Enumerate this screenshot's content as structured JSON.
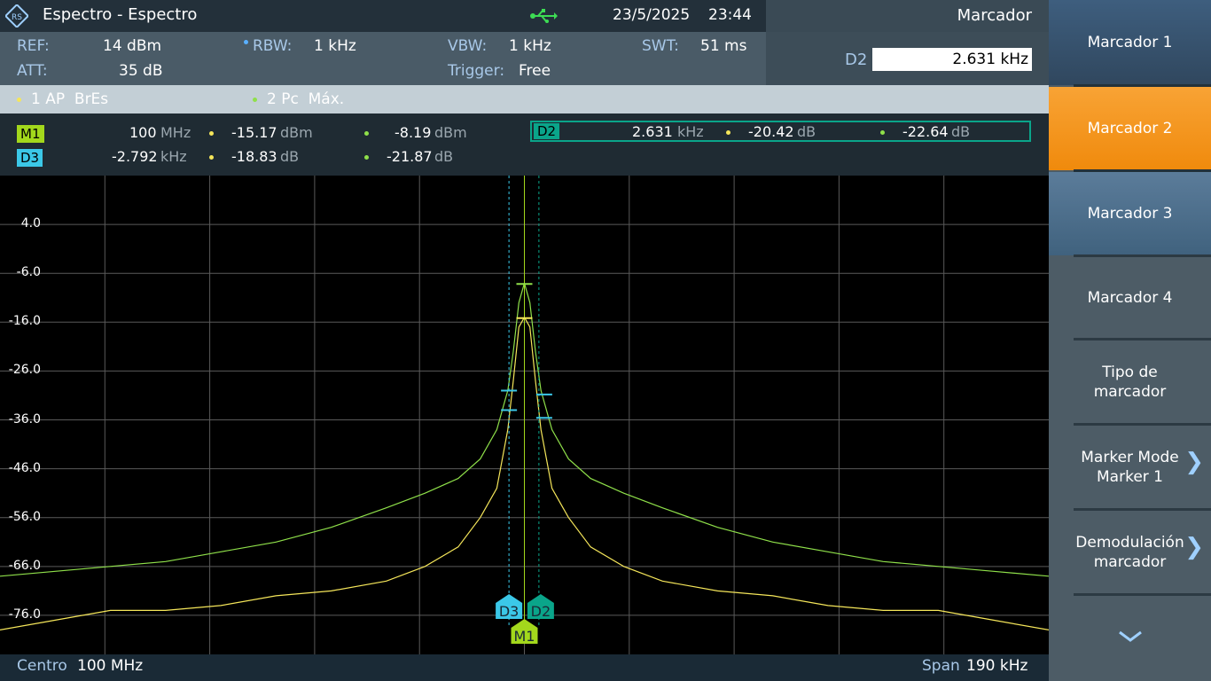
{
  "titlebar": {
    "logo": "rohde-schwarz-logo",
    "title": "Espectro - Espectro",
    "usb_icon": "usb-icon",
    "date": "23/5/2025",
    "time": "23:44",
    "panel_title": "Marcador"
  },
  "settings": {
    "ref_label": "REF:",
    "ref_value": "14 dBm",
    "att_label": "ATT:",
    "att_value": "35 dB",
    "rbw_label": "RBW:",
    "rbw_value": "1 kHz",
    "vbw_label": "VBW:",
    "vbw_value": "1 kHz",
    "trigger_label": "Trigger:",
    "trigger_value": "Free",
    "swt_label": "SWT:",
    "swt_value": "51 ms",
    "marker_input_label": "D2",
    "marker_input_value": "2.631 kHz"
  },
  "traces": {
    "t1": "1 AP  BrEs",
    "t2": "2 Pc  Máx."
  },
  "marker_table": {
    "m1": {
      "tag": "M1",
      "x_val": "100",
      "x_unit": "MHz",
      "t1_val": "-15.17",
      "t1_unit": "dBm",
      "t2_val": "-8.19",
      "t2_unit": "dBm"
    },
    "d3": {
      "tag": "D3",
      "x_val": "-2.792",
      "x_unit": "kHz",
      "t1_val": "-18.83",
      "t1_unit": "dB",
      "t2_val": "-21.87",
      "t2_unit": "dB"
    },
    "d2": {
      "tag": "D2",
      "x_val": "2.631",
      "x_unit": "kHz",
      "t1_val": "-20.42",
      "t1_unit": "dB",
      "t2_val": "-22.64",
      "t2_unit": "dB"
    }
  },
  "bottom": {
    "center_label": "Centro",
    "center_value": "100 MHz",
    "span_label": "Span",
    "span_value": "190 kHz"
  },
  "sidepanel": {
    "b1": "Marcador 1",
    "b2": "Marcador 2",
    "b3": "Marcador 3",
    "b4": "Marcador 4",
    "b5_l1": "Tipo de",
    "b5_l2": "marcador",
    "b6_l1": "Marker Mode",
    "b6_l2": "Marker 1",
    "b7_l1": "Demodulación",
    "b7_l2": "marcador",
    "more_icon": "chevron-down-icon"
  },
  "colors": {
    "accent_orange": "#f7941d",
    "trace1_yellow": "#f5e65a",
    "trace2_green": "#8fe04a",
    "marker_cyan": "#3bc8e8",
    "marker_teal": "#0aa58a"
  },
  "chart_data": {
    "type": "line",
    "ylabels": [
      "4.0",
      "-6.0",
      "-16.0",
      "-26.0",
      "-36.0",
      "-46.0",
      "-56.0",
      "-66.0",
      "-76.0"
    ],
    "ylim": [
      -84.0,
      14.0
    ],
    "xlim_khz": [
      -95,
      95
    ],
    "grid": true,
    "markers": [
      {
        "name": "M1",
        "x_khz": 0.0
      },
      {
        "name": "D3",
        "x_khz": -2.792
      },
      {
        "name": "D2",
        "x_khz": 2.631
      }
    ],
    "series": [
      {
        "name": "1 AP BrEs",
        "color": "#f5e65a",
        "x": [
          -95,
          -85,
          -75,
          -65,
          -55,
          -45,
          -35,
          -25,
          -18,
          -12,
          -8,
          -5,
          -3,
          -2,
          -1,
          0,
          1,
          2,
          3,
          5,
          8,
          12,
          18,
          25,
          35,
          45,
          55,
          65,
          75,
          85,
          95
        ],
        "y": [
          -79,
          -77,
          -75,
          -75,
          -74,
          -72,
          -71,
          -69,
          -66,
          -62,
          -56,
          -50,
          -38,
          -28,
          -17,
          -15,
          -17,
          -28,
          -38,
          -50,
          -56,
          -62,
          -66,
          -69,
          -71,
          -72,
          -74,
          -75,
          -75,
          -77,
          -79
        ]
      },
      {
        "name": "2 Pc Máx.",
        "color": "#8fe04a",
        "x": [
          -95,
          -85,
          -75,
          -65,
          -55,
          -45,
          -35,
          -25,
          -18,
          -12,
          -8,
          -5,
          -3,
          -2,
          -1,
          0,
          1,
          2,
          3,
          5,
          8,
          12,
          18,
          25,
          35,
          45,
          55,
          65,
          75,
          85,
          95
        ],
        "y": [
          -68,
          -67,
          -66,
          -65,
          -63,
          -61,
          -58,
          -54,
          -51,
          -48,
          -44,
          -38,
          -30,
          -22,
          -12,
          -8,
          -12,
          -22,
          -30,
          -38,
          -44,
          -48,
          -51,
          -54,
          -58,
          -61,
          -63,
          -65,
          -66,
          -67,
          -68
        ]
      }
    ]
  }
}
